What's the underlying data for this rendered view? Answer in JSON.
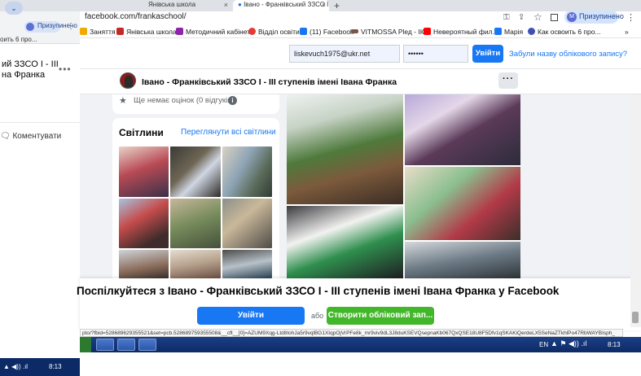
{
  "background_window": {
    "tab_dropdown": "⌄",
    "profile_label": "Призупинено",
    "bookmark_text": "оить 6 про...",
    "post_title": "ий ЗЗСО І - ІІІ на Франка",
    "comment_label": "Коментувати",
    "taskbar_time": "8:13"
  },
  "tabs": [
    {
      "label": "Янівська школа"
    },
    {
      "label": "Івано - Франківський ЗЗСО І - ІІ"
    }
  ],
  "address_bar": {
    "url": "facebook.com/frankaschool/",
    "profile_label": "Призупинено"
  },
  "bookmarks": [
    {
      "label": "Заняття",
      "color": "#f2a900"
    },
    {
      "label": "Янівська школа",
      "color": "#c62828"
    },
    {
      "label": "Методичний кабінет",
      "color": "#8e24aa"
    },
    {
      "label": "Відділ освіти",
      "color": "#e53935"
    },
    {
      "label": "(11) Facebook",
      "color": "#1877f2"
    },
    {
      "label": "VITMOSSA Plед - ІК...",
      "color": "#795548"
    },
    {
      "label": "Невероятный фил...",
      "color": "#ff0000"
    },
    {
      "label": "Марія",
      "color": "#1877f2"
    },
    {
      "label": "Как освоить 6 про...",
      "color": "#3f51b5"
    }
  ],
  "login_bar": {
    "email_value": "liskevuch1975@ukr.net",
    "password_value": "••••••",
    "login_label": "Увійти",
    "forgot_label": "Забули назву облікового запису?"
  },
  "page_header": {
    "name": "Івано - Франківський ЗЗСО І - ІІІ ступенів імені Івана Франка",
    "more_label": "···"
  },
  "ratings": {
    "text": "Ще немає оцінок (0 відгуків)",
    "info": "i"
  },
  "photos": {
    "title": "Світлини",
    "see_all": "Переглянути всі світлини"
  },
  "banner": {
    "title": "Поспілкуйтеся з Івано - Франківський ЗЗСО І - ІІІ ступенів імені Івана Франка у Facebook",
    "login_label": "Увійти",
    "or_label": "або",
    "create_label": "Створити обліковий зап..."
  },
  "status_url": "pto/?fbid=528689629355521&set=pcb.528689759355508&__cft__[0]=AZUM9Xqg-Ltd8IohJa5r9vqlBG1XIqpOjVrPFe8k_mr9viv9dL3J8duKSEVQsepnaKb067QxQSE18U8F5Dfv1qSKAKiQerdeLX5SeNaZTkhlPo47RbWAYBIsph_",
  "taskbar": {
    "lang": "EN",
    "time": "8:13"
  },
  "colors": {
    "fb_blue": "#1877f2",
    "fb_green": "#42b72a",
    "feed_bg": "#f0f2f5"
  }
}
